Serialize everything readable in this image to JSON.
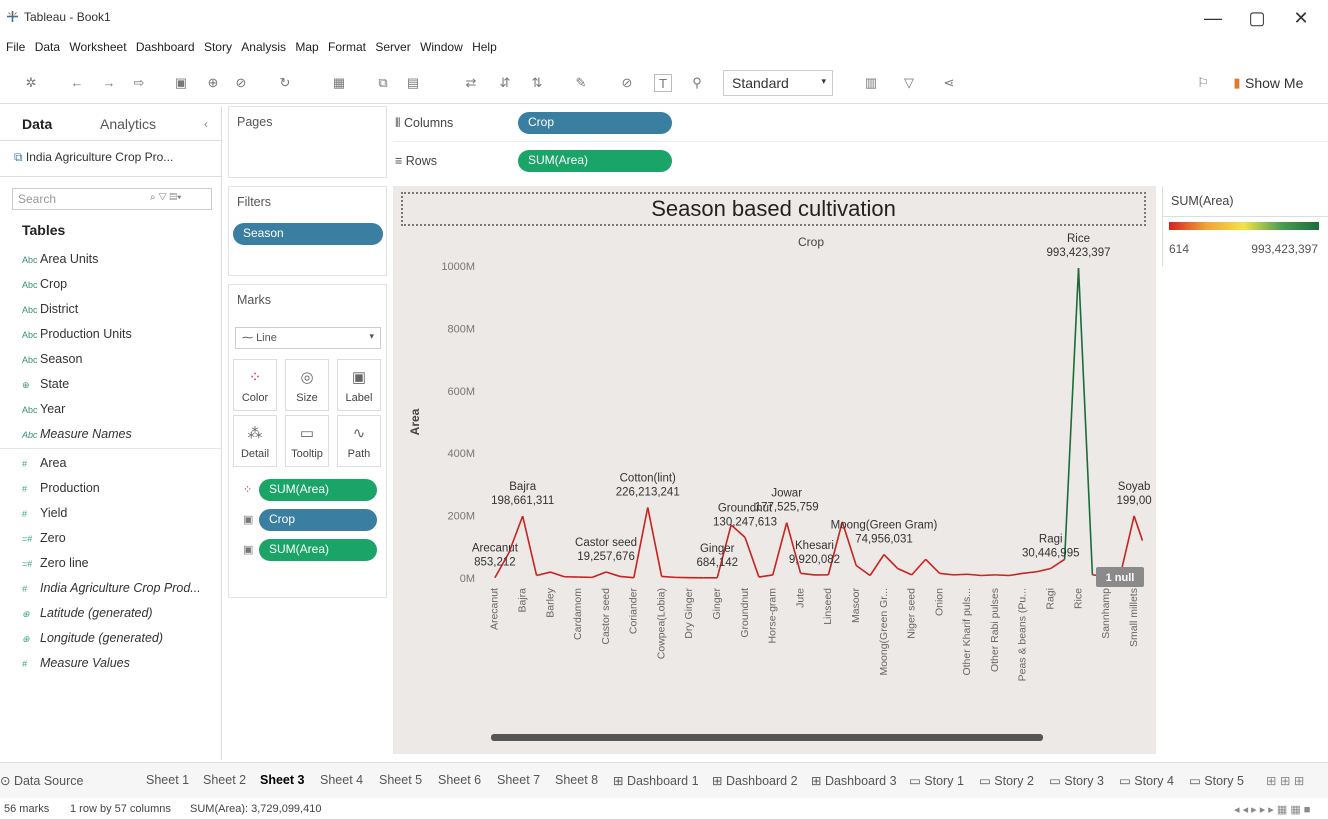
{
  "window": {
    "title": "Tableau - Book1",
    "minimize": "—",
    "restore": "▢",
    "close": "✕"
  },
  "menu": [
    "File",
    "Data",
    "Worksheet",
    "Dashboard",
    "Story",
    "Analysis",
    "Map",
    "Format",
    "Server",
    "Window",
    "Help"
  ],
  "toolbar": {
    "fit_select": "Standard",
    "show_me": "Show Me"
  },
  "datapane": {
    "tab_data": "Data",
    "tab_analytics": "Analytics",
    "source": "India Agriculture Crop Pro...",
    "search_placeholder": "Search",
    "tables_heading": "Tables",
    "dimensions": [
      "Area Units",
      "Crop",
      "District",
      "Production Units",
      "Season",
      "State",
      "Year"
    ],
    "measure_names": "Measure Names",
    "measures": [
      "Area",
      "Production",
      "Yield",
      "Zero",
      "Zero line"
    ],
    "measures_italic": [
      "India Agriculture Crop Prod...",
      "Latitude (generated)",
      "Longitude (generated)",
      "Measure Values"
    ]
  },
  "shelves": {
    "pages_label": "Pages",
    "filters_label": "Filters",
    "filter_pill": "Season",
    "columns_label": "Columns",
    "columns_pill": "Crop",
    "rows_label": "Rows",
    "rows_pill": "SUM(Area)",
    "marks_label": "Marks",
    "mark_type": "Line",
    "mark_buttons": [
      "Color",
      "Size",
      "Label",
      "Detail",
      "Tooltip",
      "Path"
    ],
    "mark_pills": [
      "SUM(Area)",
      "Crop",
      "SUM(Area)"
    ]
  },
  "legend": {
    "title": "SUM(Area)",
    "min": "614",
    "max": "993,423,397"
  },
  "sheets": [
    "Data Source",
    "Sheet 1",
    "Sheet 2",
    "Sheet 3",
    "Sheet 4",
    "Sheet 5",
    "Sheet 6",
    "Sheet 7",
    "Sheet 8",
    "Dashboard 1",
    "Dashboard 2",
    "Dashboard 3",
    "Story 1",
    "Story 2",
    "Story 3",
    "Story 4",
    "Story 5"
  ],
  "active_sheet": "Sheet 3",
  "status": {
    "marks": "56 marks",
    "rows_cols": "1 row by 57 columns",
    "sum": "SUM(Area): 3,729,099,410"
  },
  "colors": {
    "pill_blue": "#3a7ea1",
    "pill_green": "#1aa467",
    "line_red": "#d6231f",
    "line_green": "#1a6d3a"
  },
  "chart_data": {
    "type": "line",
    "title": "Season based cultivation",
    "xlabel": "Crop",
    "ylabel": "Area",
    "ylim": [
      0,
      1000000000
    ],
    "yticks": [
      "0M",
      "200M",
      "400M",
      "600M",
      "800M",
      "1000M"
    ],
    "categories": [
      "Arecanut",
      "Bajra",
      "Barley",
      "Cardamom",
      "Castor seed",
      "Coriander",
      "Cowpea(Lobia)",
      "Dry Ginger",
      "Ginger",
      "Groundnut",
      "Horse-gram",
      "Jute",
      "Linseed",
      "Masoor",
      "Moong(Green Gr...",
      "Niger seed",
      "Onion",
      "Other Kharif puls...",
      "Other Rabi pulses",
      "Peas & beans (Pu...",
      "Ragi",
      "Rice",
      "Sannhamp",
      "Small millets"
    ],
    "series_points": [
      {
        "x": 0,
        "y": 853212
      },
      {
        "x": 0.5,
        "y": 80000000
      },
      {
        "x": 1,
        "y": 198661311
      },
      {
        "x": 1.5,
        "y": 8000000
      },
      {
        "x": 2,
        "y": 19000000
      },
      {
        "x": 2.5,
        "y": 4000000
      },
      {
        "x": 3,
        "y": 3000000
      },
      {
        "x": 3.5,
        "y": 2000000
      },
      {
        "x": 4,
        "y": 19257676
      },
      {
        "x": 4.5,
        "y": 5000000
      },
      {
        "x": 5,
        "y": 1000000
      },
      {
        "x": 5.5,
        "y": 226213241
      },
      {
        "x": 6,
        "y": 5000000
      },
      {
        "x": 6.5,
        "y": 2000000
      },
      {
        "x": 7,
        "y": 1000000
      },
      {
        "x": 7.5,
        "y": 684142
      },
      {
        "x": 8,
        "y": 684142
      },
      {
        "x": 8.5,
        "y": 170000000
      },
      {
        "x": 9,
        "y": 130247613
      },
      {
        "x": 9.5,
        "y": 3000000
      },
      {
        "x": 10,
        "y": 9920082
      },
      {
        "x": 10.5,
        "y": 177525759
      },
      {
        "x": 11,
        "y": 15000000
      },
      {
        "x": 11.5,
        "y": 9920082
      },
      {
        "x": 12,
        "y": 10000000
      },
      {
        "x": 12.5,
        "y": 180000000
      },
      {
        "x": 13,
        "y": 40000000
      },
      {
        "x": 13.5,
        "y": 8000000
      },
      {
        "x": 14,
        "y": 74956031
      },
      {
        "x": 14.5,
        "y": 30000000
      },
      {
        "x": 15,
        "y": 10000000
      },
      {
        "x": 15.5,
        "y": 60000000
      },
      {
        "x": 16,
        "y": 15000000
      },
      {
        "x": 16.5,
        "y": 10000000
      },
      {
        "x": 17,
        "y": 12000000
      },
      {
        "x": 17.5,
        "y": 8000000
      },
      {
        "x": 18,
        "y": 10000000
      },
      {
        "x": 18.5,
        "y": 8000000
      },
      {
        "x": 19,
        "y": 15000000
      },
      {
        "x": 19.5,
        "y": 20000000
      },
      {
        "x": 20,
        "y": 30446995
      },
      {
        "x": 20.5,
        "y": 60000000
      },
      {
        "x": 21,
        "y": 993423397
      },
      {
        "x": 21.5,
        "y": 10000000
      },
      {
        "x": 22,
        "y": 5000000
      },
      {
        "x": 22.5,
        "y": 8000000
      },
      {
        "x": 23,
        "y": 199000000
      },
      {
        "x": 23.3,
        "y": 120000000
      }
    ],
    "labels": [
      {
        "text": "Arecanut",
        "value": "853,212",
        "x": 0,
        "y": 853212
      },
      {
        "text": "Bajra",
        "value": "198,661,311",
        "x": 1,
        "y": 198661311
      },
      {
        "text": "Castor seed",
        "value": "19,257,676",
        "x": 4,
        "y": 19257676
      },
      {
        "text": "Cotton(lint)",
        "value": "226,213,241",
        "x": 5.5,
        "y": 226213241
      },
      {
        "text": "Ginger",
        "value": "684,142",
        "x": 8,
        "y": 684142
      },
      {
        "text": "Groundnut",
        "value": "130,247,613",
        "x": 9,
        "y": 130247613
      },
      {
        "text": "Jowar",
        "value": "177,525,759",
        "x": 10.5,
        "y": 177525759
      },
      {
        "text": "Khesari",
        "value": "9,920,082",
        "x": 11.5,
        "y": 9920082
      },
      {
        "text": "Moong(Green Gram)",
        "value": "74,956,031",
        "x": 14,
        "y": 74956031
      },
      {
        "text": "Ragi",
        "value": "30,446,995",
        "x": 20,
        "y": 30446995
      },
      {
        "text": "Rice",
        "value": "993,423,397",
        "x": 21,
        "y": 993423397
      },
      {
        "text": "Soyab",
        "value": "199,00",
        "x": 23,
        "y": 199000000
      }
    ],
    "null_badge": "1 null"
  }
}
